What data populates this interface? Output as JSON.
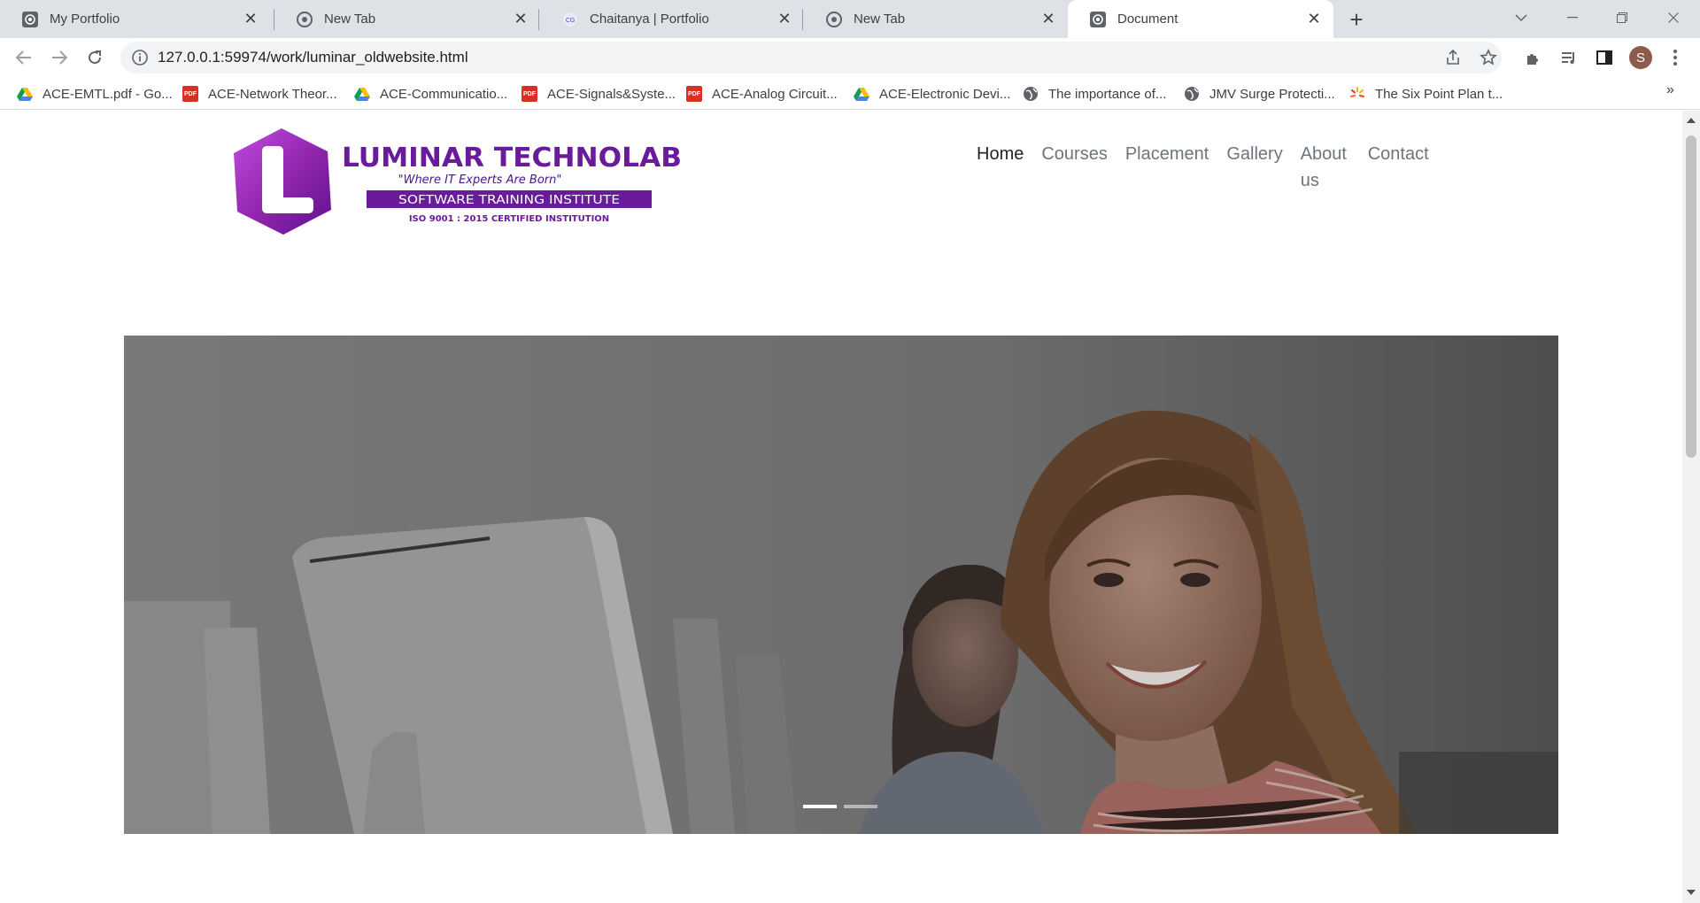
{
  "browser": {
    "tabs": [
      {
        "title": "My Portfolio",
        "icon": "radio-waves-icon",
        "active": false
      },
      {
        "title": "New Tab",
        "icon": "chrome-icon",
        "active": false
      },
      {
        "title": "Chaitanya | Portfolio",
        "icon": "cg-icon",
        "active": false
      },
      {
        "title": "New Tab",
        "icon": "chrome-icon",
        "active": false
      },
      {
        "title": "Document",
        "icon": "radio-waves-icon",
        "active": true
      }
    ],
    "url": "127.0.0.1:59974/work/luminar_oldwebsite.html",
    "profile_initial": "S",
    "bookmarks": [
      {
        "label": "ACE-EMTL.pdf - Go...",
        "icon": "google-drive-icon"
      },
      {
        "label": "ACE-Network Theor...",
        "icon": "pdf-icon"
      },
      {
        "label": "ACE-Communicatio...",
        "icon": "google-drive-icon"
      },
      {
        "label": "ACE-Signals&Syste...",
        "icon": "pdf-icon"
      },
      {
        "label": "ACE-Analog Circuit...",
        "icon": "pdf-icon"
      },
      {
        "label": "ACE-Electronic Devi...",
        "icon": "google-drive-icon"
      },
      {
        "label": "The importance of...",
        "icon": "globe-icon"
      },
      {
        "label": "JMV Surge Protecti...",
        "icon": "globe-icon"
      },
      {
        "label": "The Six Point Plan t...",
        "icon": "sparkle-icon"
      }
    ],
    "bookmarks_overflow": "»"
  },
  "page": {
    "logo": {
      "letter": "L",
      "name": "LUMINAR TECHNOLAB",
      "tagline": "\"Where IT Experts Are Born\"",
      "banner": "SOFTWARE TRAINING INSTITUTE",
      "cert": "ISO 9001 : 2015 CERTIFIED INSTITUTION"
    },
    "nav": [
      {
        "label": "Home",
        "active": true
      },
      {
        "label": "Courses",
        "active": false
      },
      {
        "label": "Placement",
        "active": false
      },
      {
        "label": "Gallery",
        "active": false
      },
      {
        "label": "About us",
        "active": false
      },
      {
        "label": "Contact",
        "active": false
      }
    ],
    "carousel": {
      "slide_count": 2,
      "active_index": 0
    }
  },
  "colors": {
    "brand_purple": "#6a1b9a",
    "logo_purple_light": "#a23fd0",
    "chrome_tabstrip": "#dee1e6",
    "nav_active": "#212529",
    "nav_inactive": "#6c757d"
  }
}
